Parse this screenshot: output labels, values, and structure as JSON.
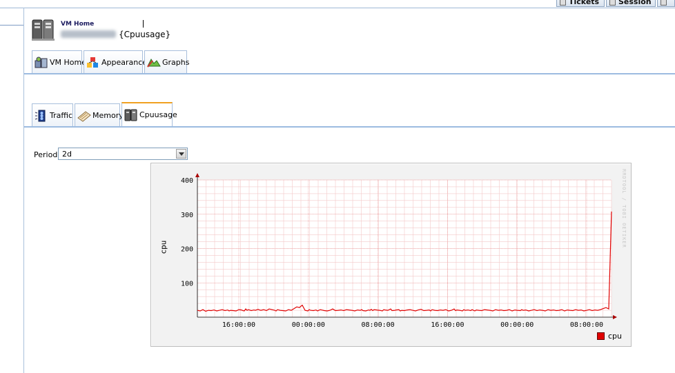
{
  "top_tabs": [
    {
      "label": "Tickets"
    },
    {
      "label": "Session"
    }
  ],
  "header": {
    "title": "VM Home",
    "host_blurred": "vm-host",
    "page": "{Cpuusage}"
  },
  "main_tabs": [
    {
      "label": "VM Home",
      "icon": "vm-home-icon"
    },
    {
      "label": "Appearance",
      "icon": "appearance-icon"
    },
    {
      "label": "Graphs",
      "icon": "graphs-icon"
    }
  ],
  "graph_tabs": [
    {
      "label": "Traffic",
      "icon": "traffic-icon",
      "active": false
    },
    {
      "label": "Memory",
      "icon": "memory-icon",
      "active": false
    },
    {
      "label": "Cpuusage",
      "icon": "cpu-icon",
      "active": true
    }
  ],
  "period": {
    "label": "Period",
    "value": "2d"
  },
  "colors": {
    "series": "#e00000",
    "accent_tab": "#f0a020",
    "frame": "#9cbbe0"
  },
  "chart_data": {
    "type": "line",
    "ylabel": "cpu",
    "ylim": [
      0,
      400
    ],
    "yticks": [
      100,
      200,
      300,
      400
    ],
    "xticks": [
      "16:00:00",
      "00:00:00",
      "08:00:00",
      "16:00:00",
      "00:00:00",
      "08:00:00"
    ],
    "credit": "RRDTOOL / TOBI OETIKER",
    "legend": [
      "cpu"
    ],
    "grid": true,
    "series": [
      {
        "name": "cpu",
        "x": [
          0,
          4,
          8,
          12,
          16,
          20,
          24,
          28,
          32,
          36,
          40,
          44,
          46,
          48,
          52,
          56,
          58,
          60,
          64,
          66,
          68,
          70,
          72,
          74,
          78,
          82,
          84,
          88,
          90,
          92,
          96,
          100,
          104,
          108,
          112,
          114,
          116,
          118,
          120,
          124,
          128,
          132,
          136,
          140,
          144,
          148,
          150,
          152,
          156,
          160,
          162,
          164,
          168,
          172,
          174,
          176,
          178,
          180,
          184,
          188,
          192,
          196,
          200,
          204,
          208,
          212,
          216,
          220,
          224,
          228,
          232,
          236,
          238,
          240,
          244,
          248,
          250,
          252,
          254,
          256,
          260,
          264,
          268,
          270,
          272,
          276,
          280,
          282,
          286,
          288,
          292,
          294,
          296,
          300,
          304,
          308,
          312,
          316,
          320,
          324,
          328,
          332,
          336,
          338,
          340,
          344,
          348,
          352,
          356,
          360,
          364,
          368,
          372,
          374,
          376,
          380,
          384,
          386,
          388,
          392,
          396,
          398,
          400,
          402,
          404,
          408,
          412,
          416,
          420,
          424,
          428,
          432,
          436,
          440,
          444,
          448,
          452,
          456,
          460,
          464,
          468,
          470,
          472,
          476,
          480,
          484,
          488,
          492,
          496,
          500,
          504,
          508,
          512,
          516,
          520,
          524,
          528,
          532,
          536,
          540,
          544,
          548,
          552,
          556,
          560,
          564,
          568,
          572,
          576,
          580,
          584,
          588,
          592,
          596,
          600
        ],
        "values": [
          20,
          18,
          22,
          17,
          20,
          19,
          21,
          18,
          20,
          22,
          19,
          21,
          18,
          20,
          19,
          18,
          20,
          22,
          21,
          19,
          18,
          24,
          20,
          22,
          19,
          21,
          20,
          23,
          21,
          20,
          22,
          19,
          24,
          22,
          20,
          18,
          22,
          21,
          20,
          19,
          18,
          22,
          20,
          25,
          30,
          28,
          32,
          35,
          20,
          18,
          22,
          20,
          19,
          21,
          18,
          20,
          22,
          21,
          19,
          18,
          20,
          24,
          19,
          20,
          21,
          19,
          22,
          21,
          20,
          18,
          21,
          20,
          22,
          19,
          18,
          21,
          20,
          23,
          19,
          22,
          21,
          20,
          18,
          22,
          21,
          20,
          24,
          19,
          20,
          21,
          22,
          18,
          20,
          19,
          21,
          22,
          20,
          18,
          21,
          23,
          19,
          20,
          21,
          18,
          22,
          20,
          19,
          21,
          20,
          22,
          18,
          20,
          24,
          19,
          21,
          20,
          18,
          22,
          20,
          21,
          19,
          22,
          20,
          18,
          21,
          20,
          19,
          22,
          21,
          20,
          18,
          22,
          20,
          21,
          19,
          20,
          22,
          18,
          21,
          20,
          19,
          22,
          20,
          21,
          18,
          20,
          22,
          19,
          21,
          20,
          18,
          22,
          20,
          21,
          19,
          20,
          22,
          18,
          21,
          20,
          19,
          22,
          20,
          21,
          18,
          20,
          22,
          19,
          21,
          20,
          22,
          25,
          28,
          24,
          308
        ]
      }
    ]
  }
}
